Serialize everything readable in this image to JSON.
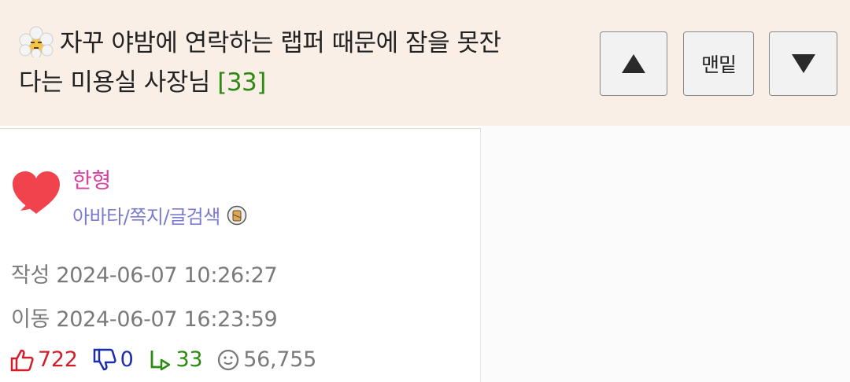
{
  "post": {
    "title_line1": "자꾸 야밤에 연락하는 랩퍼 때문에 잠을 못잔",
    "title_line2": "다는 미용실 사장님",
    "comment_count": "[33]"
  },
  "nav": {
    "up_icon": "triangle-up-icon",
    "bottom_label": "맨밑",
    "down_icon": "triangle-down-icon"
  },
  "author": {
    "name": "한형",
    "links": "아바타/쪽지/글검색"
  },
  "meta": {
    "written": "작성 2024-06-07 10:26:27",
    "moved": "이동 2024-06-07 16:23:59"
  },
  "stats": {
    "upvotes": "722",
    "downvotes": "0",
    "replies": "33",
    "views": "56,755"
  },
  "colors": {
    "topbar_bg": "#f9efe6",
    "author": "#d6409f",
    "links": "#7b7bd0",
    "upvote": "#d21e2b",
    "downvote": "#1d2fa8",
    "reply": "#2d8a12"
  }
}
